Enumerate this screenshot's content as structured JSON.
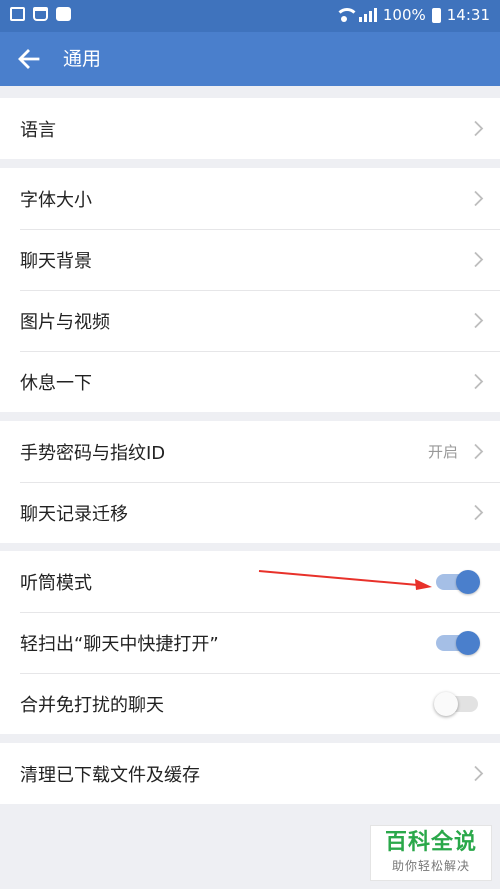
{
  "status_bar": {
    "battery_text": "100%",
    "time": "14:31",
    "icons": [
      "image-icon",
      "shopping-bag-icon",
      "message-icon",
      "wifi-icon",
      "signal-icon",
      "battery-icon"
    ]
  },
  "app_bar": {
    "back_icon": "arrow-left-icon",
    "title": "通用"
  },
  "groups": [
    {
      "items": [
        {
          "label": "语言",
          "control": "chevron"
        }
      ]
    },
    {
      "items": [
        {
          "label": "字体大小",
          "control": "chevron"
        },
        {
          "label": "聊天背景",
          "control": "chevron"
        },
        {
          "label": "图片与视频",
          "control": "chevron"
        },
        {
          "label": "休息一下",
          "control": "chevron"
        }
      ]
    },
    {
      "items": [
        {
          "label": "手势密码与指纹ID",
          "value": "开启",
          "control": "chevron"
        },
        {
          "label": "聊天记录迁移",
          "control": "chevron"
        }
      ]
    },
    {
      "items": [
        {
          "label": "听筒模式",
          "control": "toggle",
          "on": true
        },
        {
          "label": "轻扫出“聊天中快捷打开”",
          "control": "toggle",
          "on": true
        },
        {
          "label": "合并免打扰的聊天",
          "control": "toggle",
          "on": false
        }
      ]
    },
    {
      "items": [
        {
          "label": "清理已下载文件及缓存",
          "control": "chevron"
        }
      ]
    }
  ],
  "annotation": {
    "type": "red-arrow",
    "color": "#e8312a"
  },
  "watermark": {
    "title": "百科全说",
    "subtitle": "助你轻松解决"
  },
  "colors": {
    "status_bar": "#3f73bd",
    "app_bar": "#4a7fcc",
    "accent": "#4a7fcc",
    "background": "#eeeff3"
  }
}
